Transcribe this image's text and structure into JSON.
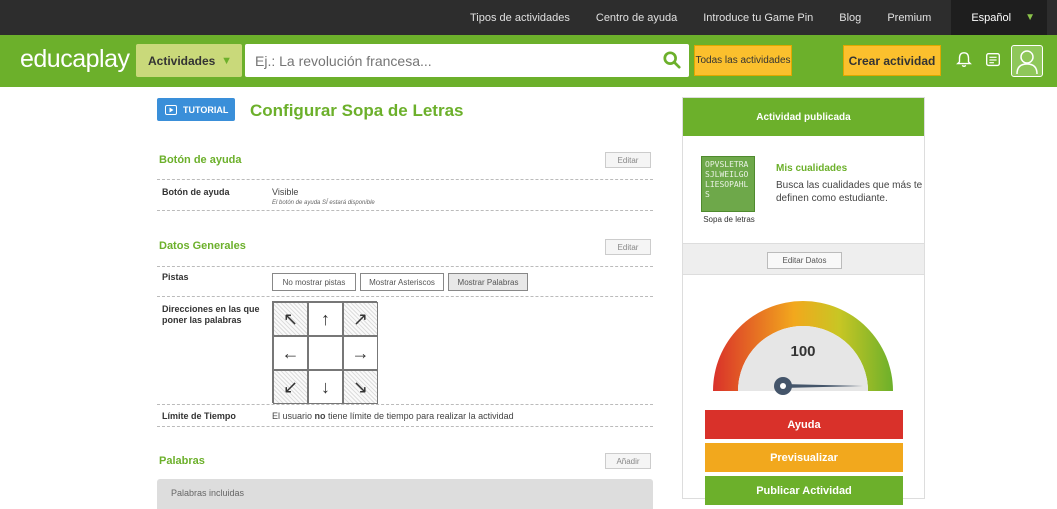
{
  "topnav": {
    "links": [
      "Tipos de actividades",
      "Centro de ayuda",
      "Introduce tu Game Pin",
      "Blog",
      "Premium"
    ],
    "language": "Español"
  },
  "header": {
    "logo_a": "educa",
    "logo_b": "play",
    "activities_dropdown": "Actividades",
    "search_placeholder": "Ej.: La revolución francesa...",
    "all_activities": "Todas las actividades",
    "create_activity": "Crear actividad"
  },
  "main": {
    "tutorial_label": "TUTORIAL",
    "page_title": "Configurar Sopa de Letras",
    "help_section": {
      "title": "Botón de ayuda",
      "edit_label": "Editar",
      "row_label": "Botón de ayuda",
      "row_value": "Visible",
      "row_sub": "El botón de ayuda SÍ estará disponible"
    },
    "general_section": {
      "title": "Datos Generales",
      "edit_label": "Editar",
      "hints_label": "Pistas",
      "hint_options": [
        "No mostrar pistas",
        "Mostrar Asteriscos",
        "Mostrar Palabras"
      ],
      "hint_selected": "Mostrar Palabras",
      "directions_label": "Direcciones en las que poner las palabras",
      "directions": [
        "↖",
        "↑",
        "↗",
        "←",
        "",
        "→",
        "↙",
        "↓",
        "↘"
      ],
      "directions_enabled": [
        true,
        false,
        true,
        false,
        false,
        false,
        true,
        false,
        true
      ],
      "time_label": "Límite de Tiempo",
      "time_prefix": "El usuario ",
      "time_bold": "no",
      "time_suffix": " tiene límite de tiempo para realizar la actividad"
    },
    "words_section": {
      "title": "Palabras",
      "add_label": "Añadir",
      "included_label": "Palabras incluidas"
    }
  },
  "side_panel": {
    "header": "Actividad publicada",
    "thumb_letters": "OPVSLETRASJLWEILGOLIESOPAHLS",
    "thumb_caption": "Sopa de letras",
    "activity_title": "Mis cualidades",
    "activity_desc": "Busca las cualidades que más te definen como estudiante.",
    "edit_data": "Editar Datos",
    "score": "100",
    "buttons": {
      "help": "Ayuda",
      "preview": "Previsualizar",
      "publish": "Publicar Actividad"
    }
  },
  "colors": {
    "brand_green": "#6cb02b",
    "accent_yellow": "#fbc02d",
    "tutorial_blue": "#3a8fd9",
    "help_red": "#d9312a",
    "preview_orange": "#f2a81d"
  }
}
